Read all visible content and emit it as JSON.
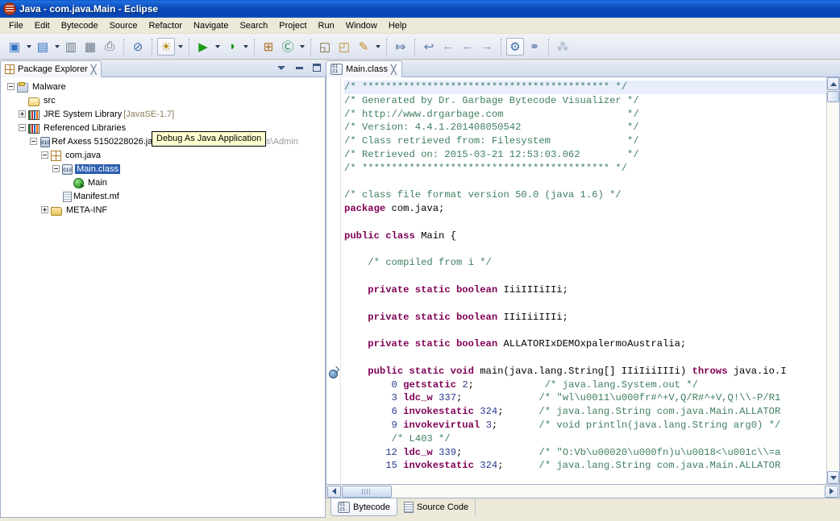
{
  "window": {
    "title": "Java - com.java.Main - Eclipse",
    "system_icon": "eclipse-icon"
  },
  "menubar": {
    "items": [
      {
        "label": "File"
      },
      {
        "label": "Edit"
      },
      {
        "label": "Bytecode"
      },
      {
        "label": "Source"
      },
      {
        "label": "Refactor"
      },
      {
        "label": "Navigate"
      },
      {
        "label": "Search"
      },
      {
        "label": "Project"
      },
      {
        "label": "Run"
      },
      {
        "label": "Window"
      },
      {
        "label": "Help"
      }
    ]
  },
  "toolbar": {
    "buttons": [
      {
        "name": "new-wizard-icon",
        "glyph": "▣",
        "dropdown": true
      },
      {
        "name": "new-java-class-icon",
        "glyph": "▤",
        "dropdown": true
      },
      {
        "name": "save-icon",
        "glyph": "▥",
        "dropdown": false
      },
      {
        "name": "save-all-icon",
        "glyph": "▦",
        "dropdown": false
      },
      {
        "name": "print-icon",
        "glyph": "⎙",
        "dropdown": false
      },
      {
        "name": "toggle-breakpoint-icon",
        "glyph": "⊘",
        "dropdown": false
      },
      {
        "name": "debug-icon",
        "glyph": "☀",
        "dropdown": true
      },
      {
        "name": "run-icon",
        "glyph": "▶",
        "dropdown": true
      },
      {
        "name": "run-external-tools-icon",
        "glyph": "◑",
        "dropdown": true
      },
      {
        "name": "new-java-project-icon",
        "glyph": "⊞",
        "dropdown": false
      },
      {
        "name": "new-package-icon",
        "glyph": "Ⓒ",
        "dropdown": true
      },
      {
        "name": "open-type-icon",
        "glyph": "◱",
        "dropdown": false
      },
      {
        "name": "open-resource-icon",
        "glyph": "◰",
        "dropdown": false
      },
      {
        "name": "search-icon",
        "glyph": "✎",
        "dropdown": true
      },
      {
        "name": "next-annotation-icon",
        "glyph": "⤇",
        "dropdown": false
      },
      {
        "name": "previous-edit-icon",
        "glyph": "↩",
        "dropdown": false
      },
      {
        "name": "back-icon",
        "glyph": "←",
        "dropdown": false
      },
      {
        "name": "back-history-icon",
        "glyph": "←",
        "dropdown": false
      },
      {
        "name": "forward-history-icon",
        "glyph": "→",
        "dropdown": false
      },
      {
        "name": "bytecode-perspective-icon",
        "glyph": "⚙",
        "dropdown": false
      },
      {
        "name": "graph-perspective-icon",
        "glyph": "⚭",
        "dropdown": false
      },
      {
        "name": "open-perspective-icon",
        "glyph": "⁂",
        "dropdown": false
      }
    ]
  },
  "package_explorer": {
    "tab_label": "Package Explorer",
    "close_label": "╳",
    "view_menu_icon": "view-menu-icon",
    "minimize_icon": "minimize-icon",
    "maximize_icon": "maximize-icon",
    "tree": [
      {
        "label": "Malware",
        "icon": "java-project-icon",
        "indent": 0,
        "toggle": "minus",
        "selected": false
      },
      {
        "label": "src",
        "icon": "source-folder-icon",
        "indent": 1,
        "toggle": "none",
        "selected": false
      },
      {
        "label": "JRE System Library",
        "suffix": " [JavaSE-1.7]",
        "icon": "library-icon",
        "indent": 1,
        "toggle": "plus",
        "selected": false
      },
      {
        "label": "Referenced Libraries",
        "icon": "library-icon",
        "indent": 1,
        "toggle": "minus",
        "selected": false
      },
      {
        "label": "Ref  Axess 5150228026.jar",
        "suffix": " - C:\\Documents and Settings\\Admin",
        "icon": "jar-icon",
        "indent": 2,
        "toggle": "minus",
        "selected": false
      },
      {
        "label": "com.java",
        "icon": "package-icon",
        "indent": 3,
        "toggle": "minus",
        "selected": false
      },
      {
        "label": "Main.class",
        "icon": "class-file-icon",
        "indent": 4,
        "toggle": "minus",
        "selected": true
      },
      {
        "label": "Main",
        "icon": "main-method-icon",
        "indent": 5,
        "toggle": "none",
        "selected": false
      },
      {
        "label": "Manifest.mf",
        "icon": "manifest-file-icon",
        "indent": 4,
        "toggle": "none",
        "selected": false
      },
      {
        "label": "META-INF",
        "icon": "folder-icon",
        "indent": 3,
        "toggle": "plus",
        "selected": false
      }
    ]
  },
  "tooltip": {
    "text": "Debug As Java Application"
  },
  "editor": {
    "tab_label": "Main.class",
    "tab_icon": "bytecode-editor-icon",
    "close_label": "╳",
    "bottom_tabs": [
      {
        "label": "Bytecode",
        "icon": "bytecode-icon",
        "active": true
      },
      {
        "label": "Source Code",
        "icon": "source-code-icon",
        "active": false
      }
    ],
    "gutter_marker": "breakpoint-marker-icon",
    "lines": [
      {
        "current": true,
        "tokens": [
          {
            "t": "/* ****************************************** */",
            "c": "cmt"
          }
        ]
      },
      {
        "tokens": [
          {
            "t": "/* Generated by Dr. Garbage Bytecode Visualizer */",
            "c": "cmt"
          }
        ]
      },
      {
        "tokens": [
          {
            "t": "/* http://www.drgarbage.com                     */",
            "c": "cmt"
          }
        ]
      },
      {
        "tokens": [
          {
            "t": "/* Version: 4.4.1.201408050542                  */",
            "c": "cmt"
          }
        ]
      },
      {
        "tokens": [
          {
            "t": "/* Class retrieved from: Filesystem             */",
            "c": "cmt"
          }
        ]
      },
      {
        "tokens": [
          {
            "t": "/* Retrieved on: 2015-03-21 12:53:03.062        */",
            "c": "cmt"
          }
        ]
      },
      {
        "tokens": [
          {
            "t": "/* ****************************************** */",
            "c": "cmt"
          }
        ]
      },
      {
        "tokens": [
          {
            "t": "",
            "c": "op"
          }
        ]
      },
      {
        "tokens": [
          {
            "t": "/* class file format version 50.0 (java 1.6) */",
            "c": "cmt"
          }
        ]
      },
      {
        "tokens": [
          {
            "t": "package",
            "c": "kw"
          },
          {
            "t": " com.java;",
            "c": "op"
          }
        ]
      },
      {
        "tokens": [
          {
            "t": "",
            "c": "op"
          }
        ]
      },
      {
        "tokens": [
          {
            "t": "public class",
            "c": "kw"
          },
          {
            "t": " Main {",
            "c": "op"
          }
        ]
      },
      {
        "tokens": [
          {
            "t": "",
            "c": "op"
          }
        ]
      },
      {
        "tokens": [
          {
            "t": "    /* compiled from i */",
            "c": "cmt"
          }
        ]
      },
      {
        "tokens": [
          {
            "t": "",
            "c": "op"
          }
        ]
      },
      {
        "tokens": [
          {
            "t": "    ",
            "c": "op"
          },
          {
            "t": "private static boolean",
            "c": "kw"
          },
          {
            "t": " IiiIIIiIIi;",
            "c": "op"
          }
        ]
      },
      {
        "tokens": [
          {
            "t": "",
            "c": "op"
          }
        ]
      },
      {
        "tokens": [
          {
            "t": "    ",
            "c": "op"
          },
          {
            "t": "private static boolean",
            "c": "kw"
          },
          {
            "t": " IIiIiiIIIi;",
            "c": "op"
          }
        ]
      },
      {
        "tokens": [
          {
            "t": "",
            "c": "op"
          }
        ]
      },
      {
        "tokens": [
          {
            "t": "    ",
            "c": "op"
          },
          {
            "t": "private static boolean",
            "c": "kw"
          },
          {
            "t": " ALLATORIxDEMOxpalermoAustralia;",
            "c": "op"
          }
        ]
      },
      {
        "tokens": [
          {
            "t": "",
            "c": "op"
          }
        ]
      },
      {
        "tokens": [
          {
            "t": "    ",
            "c": "op"
          },
          {
            "t": "public static void",
            "c": "kw"
          },
          {
            "t": " main(java.lang.String[] IIiIiiIIIi) ",
            "c": "op"
          },
          {
            "t": "throws",
            "c": "kw"
          },
          {
            "t": " java.io.I",
            "c": "op"
          }
        ]
      },
      {
        "tokens": [
          {
            "t": "        ",
            "c": "op"
          },
          {
            "t": "0",
            "c": "num"
          },
          {
            "t": " ",
            "c": "op"
          },
          {
            "t": "getstatic",
            "c": "kw"
          },
          {
            "t": " ",
            "c": "op"
          },
          {
            "t": "2",
            "c": "num"
          },
          {
            "t": ";            ",
            "c": "op"
          },
          {
            "t": "/* java.lang.System.out */",
            "c": "cmt"
          }
        ]
      },
      {
        "tokens": [
          {
            "t": "        ",
            "c": "op"
          },
          {
            "t": "3",
            "c": "num"
          },
          {
            "t": " ",
            "c": "op"
          },
          {
            "t": "ldc_w",
            "c": "kw"
          },
          {
            "t": " ",
            "c": "op"
          },
          {
            "t": "337",
            "c": "num"
          },
          {
            "t": ";             ",
            "c": "op"
          },
          {
            "t": "/* \"wl\\u0011\\u000fr#^+V,Q/R#^+V,Q!\\\\-P/R1",
            "c": "cmt"
          }
        ]
      },
      {
        "tokens": [
          {
            "t": "        ",
            "c": "op"
          },
          {
            "t": "6",
            "c": "num"
          },
          {
            "t": " ",
            "c": "op"
          },
          {
            "t": "invokestatic",
            "c": "kw"
          },
          {
            "t": " ",
            "c": "op"
          },
          {
            "t": "324",
            "c": "num"
          },
          {
            "t": ";      ",
            "c": "op"
          },
          {
            "t": "/* java.lang.String com.java.Main.ALLATOR",
            "c": "cmt"
          }
        ]
      },
      {
        "tokens": [
          {
            "t": "        ",
            "c": "op"
          },
          {
            "t": "9",
            "c": "num"
          },
          {
            "t": " ",
            "c": "op"
          },
          {
            "t": "invokevirtual",
            "c": "kw"
          },
          {
            "t": " ",
            "c": "op"
          },
          {
            "t": "3",
            "c": "num"
          },
          {
            "t": ";       ",
            "c": "op"
          },
          {
            "t": "/* void println(java.lang.String arg0) */",
            "c": "cmt"
          }
        ]
      },
      {
        "tokens": [
          {
            "t": "        /* L403 */",
            "c": "cmt"
          }
        ]
      },
      {
        "tokens": [
          {
            "t": "       ",
            "c": "op"
          },
          {
            "t": "12",
            "c": "num"
          },
          {
            "t": " ",
            "c": "op"
          },
          {
            "t": "ldc_w",
            "c": "kw"
          },
          {
            "t": " ",
            "c": "op"
          },
          {
            "t": "339",
            "c": "num"
          },
          {
            "t": ";             ",
            "c": "op"
          },
          {
            "t": "/* \"O:Vb\\u00020\\u000fn)u\\u0018<\\u001c\\\\=a",
            "c": "cmt"
          }
        ]
      },
      {
        "tokens": [
          {
            "t": "       ",
            "c": "op"
          },
          {
            "t": "15",
            "c": "num"
          },
          {
            "t": " ",
            "c": "op"
          },
          {
            "t": "invokestatic",
            "c": "kw"
          },
          {
            "t": " ",
            "c": "op"
          },
          {
            "t": "324",
            "c": "num"
          },
          {
            "t": ";      ",
            "c": "op"
          },
          {
            "t": "/* java.lang.String com.java.Main.ALLATOR",
            "c": "cmt"
          }
        ]
      }
    ],
    "vscroll": {
      "up_icon": "scroll-up-icon",
      "down_icon": "scroll-down-icon",
      "thumb": "vscroll-thumb"
    },
    "hscroll": {
      "left_icon": "scroll-left-icon",
      "right_icon": "scroll-right-icon",
      "thumb": "hscroll-thumb"
    }
  },
  "colors": {
    "title_bar": "#0a4ab8",
    "selection": "#2a5db0",
    "comment": "#3f7f5f",
    "keyword": "#7f0055",
    "number": "#2b3a8f",
    "tooltip_bg": "#ffffd0",
    "chrome": "#ece9d8"
  }
}
